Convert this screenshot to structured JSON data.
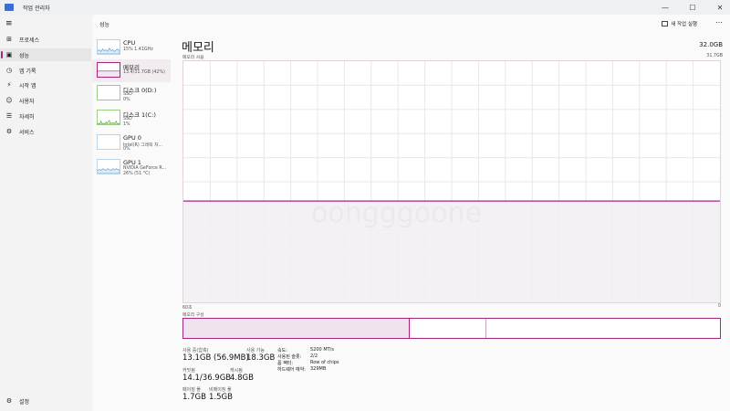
{
  "app": {
    "title": "작업 관리자"
  },
  "window_controls": {
    "minimize": "—",
    "maximize": "☐",
    "close": "✕"
  },
  "nav": {
    "menu_icon": "≡",
    "items": [
      {
        "label": "프로세스",
        "icon": "grid-icon",
        "glyph": "⊞"
      },
      {
        "label": "성능",
        "icon": "performance-icon",
        "glyph": "▣"
      },
      {
        "label": "앱 기록",
        "icon": "history-icon",
        "glyph": "◷"
      },
      {
        "label": "시작 앱",
        "icon": "startup-icon",
        "glyph": "⚡"
      },
      {
        "label": "사용자",
        "icon": "users-icon",
        "glyph": "☺"
      },
      {
        "label": "자세히",
        "icon": "details-icon",
        "glyph": "☰"
      },
      {
        "label": "서비스",
        "icon": "services-icon",
        "glyph": "⚙"
      }
    ],
    "settings": {
      "label": "설정",
      "icon": "gear-icon",
      "glyph": "⚙"
    }
  },
  "header": {
    "title": "성능",
    "run_task": "새 작업 실행",
    "more": "⋯"
  },
  "devices": [
    {
      "name": "CPU",
      "sub1": "15% 1.41GHz"
    },
    {
      "name": "메모리",
      "sub1": "13.4/31.7GB (42%)"
    },
    {
      "name": "디스크 0(D:)",
      "sub1": "SSD",
      "sub2": "0%"
    },
    {
      "name": "디스크 1(C:)",
      "sub1": "SSD",
      "sub2": "1%"
    },
    {
      "name": "GPU 0",
      "sub1": "Intel(R) 그래픽 처...",
      "sub2": "0%"
    },
    {
      "name": "GPU 1",
      "sub1": "NVIDIA GeForce R...",
      "sub2": "26% (51 °C)"
    }
  ],
  "memory": {
    "title": "메모리",
    "total": "32.0GB",
    "usage_label": "메모리 사용",
    "usage_max": "31.7GB",
    "graph_left": "60초",
    "graph_right": "0",
    "usage_fraction": 0.42,
    "composition_label": "메모리 구성",
    "composition": {
      "in_use": 0.42,
      "modified": 0.005,
      "standby": 0.14
    },
    "stats": {
      "in_use_label": "사용 중(압축)",
      "in_use": "13.1GB (56.9MB)",
      "available_label": "사용 가능",
      "available": "18.3GB",
      "committed_label": "커밋됨",
      "committed": "14.1/36.9GB",
      "cached_label": "캐시됨",
      "cached": "4.8GB",
      "paged_label": "페이징 풀",
      "paged": "1.7GB",
      "nonpaged_label": "비페이징 풀",
      "nonpaged": "1.5GB"
    },
    "details": [
      {
        "label": "속도:",
        "value": "5200 MT/s"
      },
      {
        "label": "사용된 슬롯:",
        "value": "2/2"
      },
      {
        "label": "폼 팩터:",
        "value": "Row of chips"
      },
      {
        "label": "하드웨어 예약:",
        "value": "329MB"
      }
    ]
  },
  "colors": {
    "memory": "#a4267f",
    "memory_fill": "#f2eef2",
    "grid": "#e8e8e8",
    "cpu": "#3a8ad6",
    "disk": "#4ba32a"
  },
  "watermark": "oongggoone"
}
